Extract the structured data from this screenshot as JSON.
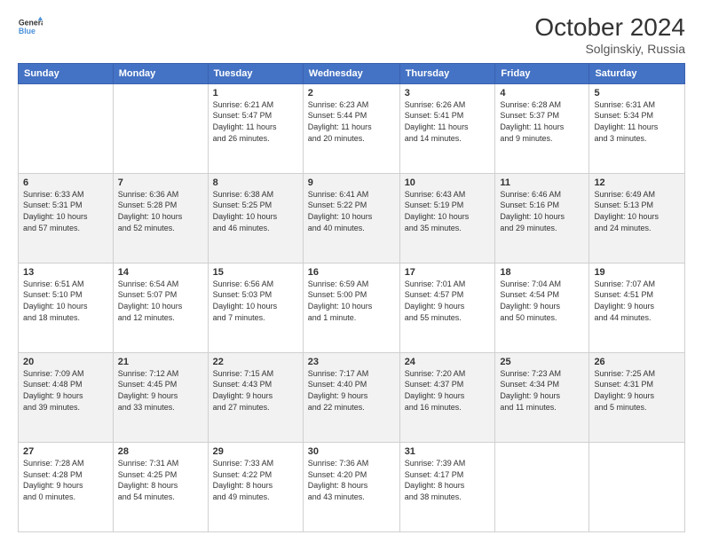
{
  "header": {
    "logo_line1": "General",
    "logo_line2": "Blue",
    "title": "October 2024",
    "subtitle": "Solginskiy, Russia"
  },
  "columns": [
    "Sunday",
    "Monday",
    "Tuesday",
    "Wednesday",
    "Thursday",
    "Friday",
    "Saturday"
  ],
  "weeks": [
    [
      {
        "day": "",
        "info": ""
      },
      {
        "day": "",
        "info": ""
      },
      {
        "day": "1",
        "info": "Sunrise: 6:21 AM\nSunset: 5:47 PM\nDaylight: 11 hours\nand 26 minutes."
      },
      {
        "day": "2",
        "info": "Sunrise: 6:23 AM\nSunset: 5:44 PM\nDaylight: 11 hours\nand 20 minutes."
      },
      {
        "day": "3",
        "info": "Sunrise: 6:26 AM\nSunset: 5:41 PM\nDaylight: 11 hours\nand 14 minutes."
      },
      {
        "day": "4",
        "info": "Sunrise: 6:28 AM\nSunset: 5:37 PM\nDaylight: 11 hours\nand 9 minutes."
      },
      {
        "day": "5",
        "info": "Sunrise: 6:31 AM\nSunset: 5:34 PM\nDaylight: 11 hours\nand 3 minutes."
      }
    ],
    [
      {
        "day": "6",
        "info": "Sunrise: 6:33 AM\nSunset: 5:31 PM\nDaylight: 10 hours\nand 57 minutes."
      },
      {
        "day": "7",
        "info": "Sunrise: 6:36 AM\nSunset: 5:28 PM\nDaylight: 10 hours\nand 52 minutes."
      },
      {
        "day": "8",
        "info": "Sunrise: 6:38 AM\nSunset: 5:25 PM\nDaylight: 10 hours\nand 46 minutes."
      },
      {
        "day": "9",
        "info": "Sunrise: 6:41 AM\nSunset: 5:22 PM\nDaylight: 10 hours\nand 40 minutes."
      },
      {
        "day": "10",
        "info": "Sunrise: 6:43 AM\nSunset: 5:19 PM\nDaylight: 10 hours\nand 35 minutes."
      },
      {
        "day": "11",
        "info": "Sunrise: 6:46 AM\nSunset: 5:16 PM\nDaylight: 10 hours\nand 29 minutes."
      },
      {
        "day": "12",
        "info": "Sunrise: 6:49 AM\nSunset: 5:13 PM\nDaylight: 10 hours\nand 24 minutes."
      }
    ],
    [
      {
        "day": "13",
        "info": "Sunrise: 6:51 AM\nSunset: 5:10 PM\nDaylight: 10 hours\nand 18 minutes."
      },
      {
        "day": "14",
        "info": "Sunrise: 6:54 AM\nSunset: 5:07 PM\nDaylight: 10 hours\nand 12 minutes."
      },
      {
        "day": "15",
        "info": "Sunrise: 6:56 AM\nSunset: 5:03 PM\nDaylight: 10 hours\nand 7 minutes."
      },
      {
        "day": "16",
        "info": "Sunrise: 6:59 AM\nSunset: 5:00 PM\nDaylight: 10 hours\nand 1 minute."
      },
      {
        "day": "17",
        "info": "Sunrise: 7:01 AM\nSunset: 4:57 PM\nDaylight: 9 hours\nand 55 minutes."
      },
      {
        "day": "18",
        "info": "Sunrise: 7:04 AM\nSunset: 4:54 PM\nDaylight: 9 hours\nand 50 minutes."
      },
      {
        "day": "19",
        "info": "Sunrise: 7:07 AM\nSunset: 4:51 PM\nDaylight: 9 hours\nand 44 minutes."
      }
    ],
    [
      {
        "day": "20",
        "info": "Sunrise: 7:09 AM\nSunset: 4:48 PM\nDaylight: 9 hours\nand 39 minutes."
      },
      {
        "day": "21",
        "info": "Sunrise: 7:12 AM\nSunset: 4:45 PM\nDaylight: 9 hours\nand 33 minutes."
      },
      {
        "day": "22",
        "info": "Sunrise: 7:15 AM\nSunset: 4:43 PM\nDaylight: 9 hours\nand 27 minutes."
      },
      {
        "day": "23",
        "info": "Sunrise: 7:17 AM\nSunset: 4:40 PM\nDaylight: 9 hours\nand 22 minutes."
      },
      {
        "day": "24",
        "info": "Sunrise: 7:20 AM\nSunset: 4:37 PM\nDaylight: 9 hours\nand 16 minutes."
      },
      {
        "day": "25",
        "info": "Sunrise: 7:23 AM\nSunset: 4:34 PM\nDaylight: 9 hours\nand 11 minutes."
      },
      {
        "day": "26",
        "info": "Sunrise: 7:25 AM\nSunset: 4:31 PM\nDaylight: 9 hours\nand 5 minutes."
      }
    ],
    [
      {
        "day": "27",
        "info": "Sunrise: 7:28 AM\nSunset: 4:28 PM\nDaylight: 9 hours\nand 0 minutes."
      },
      {
        "day": "28",
        "info": "Sunrise: 7:31 AM\nSunset: 4:25 PM\nDaylight: 8 hours\nand 54 minutes."
      },
      {
        "day": "29",
        "info": "Sunrise: 7:33 AM\nSunset: 4:22 PM\nDaylight: 8 hours\nand 49 minutes."
      },
      {
        "day": "30",
        "info": "Sunrise: 7:36 AM\nSunset: 4:20 PM\nDaylight: 8 hours\nand 43 minutes."
      },
      {
        "day": "31",
        "info": "Sunrise: 7:39 AM\nSunset: 4:17 PM\nDaylight: 8 hours\nand 38 minutes."
      },
      {
        "day": "",
        "info": ""
      },
      {
        "day": "",
        "info": ""
      }
    ]
  ]
}
